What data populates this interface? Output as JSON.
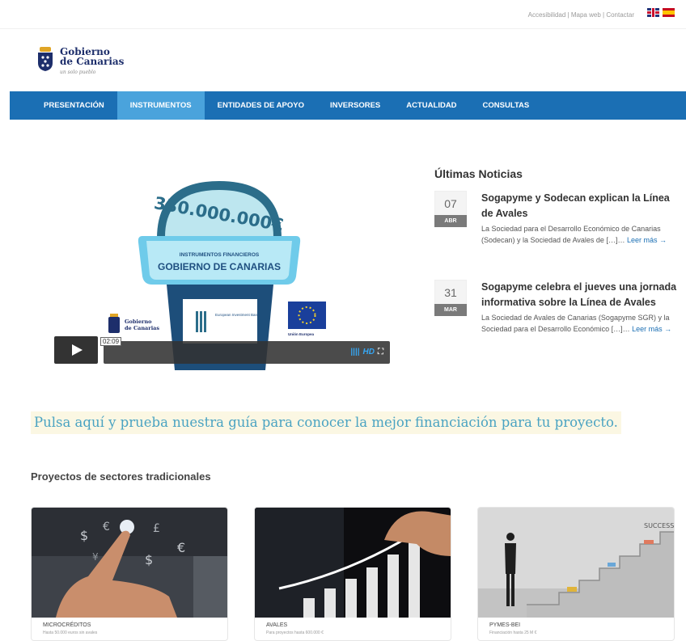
{
  "header": {
    "links": [
      "Accesibilidad",
      "Mapa web",
      "Contactar"
    ],
    "separator": " | ",
    "languages": [
      {
        "name": "English",
        "icon": "uk-flag-icon"
      },
      {
        "name": "Español",
        "icon": "spain-flag-icon"
      }
    ]
  },
  "logo": {
    "line1": "Gobierno",
    "line2": "de Canarias",
    "motto": "un solo pueblo",
    "icon": "coat-of-arms-icon"
  },
  "nav": {
    "items": [
      "PRESENTACIÓN",
      "INSTRUMENTOS",
      "ENTIDADES DE APOYO",
      "INVERSORES",
      "ACTUALIDAD",
      "CONSULTAS"
    ],
    "active_index": 1,
    "colors": {
      "bar": "#1b6fb4",
      "active": "#4aa3dc"
    }
  },
  "video": {
    "meter_amount": "330.000.000€",
    "band_small": "INSTRUMENTOS FINANCIEROS",
    "band_large": "GOBIERNO DE CANARIAS",
    "logo_line1": "Gobierno",
    "logo_line2": "de Canarias",
    "eib_text": "European Investment Bank",
    "eu_text": "Unión Europea",
    "time": "02:09",
    "hd_label": "HD",
    "icons": [
      "play-icon",
      "volume-icon",
      "fullscreen-icon"
    ]
  },
  "news": {
    "title": "Últimas Noticias",
    "items": [
      {
        "day": "07",
        "month": "ABR",
        "headline": "Sogapyme y Sodecan explican la Línea de Avales",
        "excerpt": "La Sociedad para el Desarrollo Económico de Canarias (Sodecan) y la Sociedad de Avales de […]…",
        "more": "Leer más →"
      },
      {
        "day": "31",
        "month": "MAR",
        "headline": "Sogapyme celebra el jueves una jornada informativa sobre la Línea de Avales",
        "excerpt": "La Sociedad de Avales de Canarias (Sogapyme SGR) y la Sociedad para el Desarrollo Económico […]…",
        "more": "Leer más →"
      }
    ]
  },
  "guide": {
    "text": "Pulsa aquí y prueba nuestra guía para conocer la mejor financiación para tu proyecto."
  },
  "section": {
    "title": "Proyectos de sectores tradicionales",
    "cards": [
      {
        "label": "MICROCRÉDITOS",
        "sub": "Hasta 50.000 euros sin avales"
      },
      {
        "label": "AVALES",
        "sub": "Para proyectos hasta 600.000 €"
      },
      {
        "label": "PYMES-BEI",
        "sub": "Financiación hasta 25 M €"
      }
    ]
  }
}
